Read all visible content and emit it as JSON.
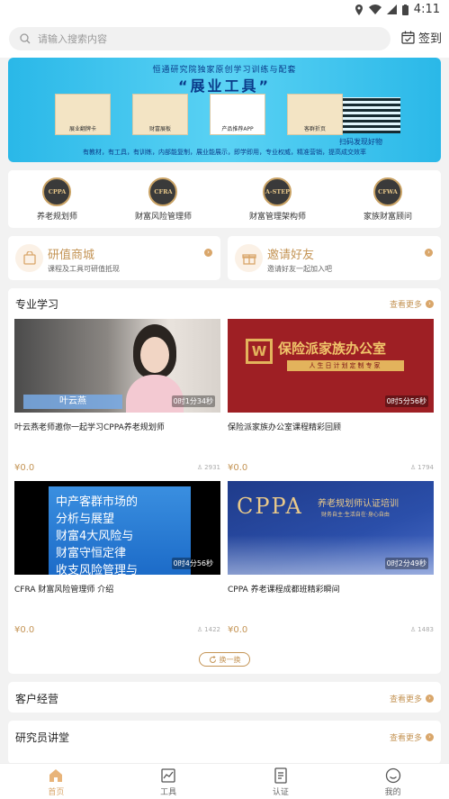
{
  "status_bar": {
    "time": "4:11"
  },
  "header": {
    "search_placeholder": "请输入搜索内容",
    "checkin_label": "签到"
  },
  "banner": {
    "heading": "恒通研究院独家原创学习训练与配套",
    "title": "“展业工具”",
    "items": [
      "展业翻牌卡",
      "财富展板",
      "产品推荐APP",
      "客群折页"
    ],
    "qr_caption": "扫码发现好物",
    "footer": "有教材，有工具，有训练，内部能复制，展业能展示，即学即用，专业权威，精准营销，提高成交效率"
  },
  "categories": [
    {
      "badge": "CPPA",
      "label": "养老规划师"
    },
    {
      "badge": "CFRA",
      "label": "财富风险管理师"
    },
    {
      "badge": "A-STEP",
      "label": "财富管理架构师"
    },
    {
      "badge": "CFWA",
      "label": "家族财富顾问"
    }
  ],
  "promos": [
    {
      "title": "研值商城",
      "subtitle": "课程及工具可研值抵现"
    },
    {
      "title": "邀请好友",
      "subtitle": "邀请好友一起加入吧"
    }
  ],
  "professional": {
    "title": "专业学习",
    "more": "查看更多",
    "refresh_label": "换一换",
    "courses": [
      {
        "title": "叶云燕老师邀你一起学习CPPA养老规划师",
        "price": "¥0.0",
        "views": "2931",
        "duration": "0时1分34秒",
        "overlay": "叶云燕"
      },
      {
        "title": "保险派家族办公室课程精彩回顾",
        "price": "¥0.0",
        "views": "1794",
        "duration": "0时5分56秒",
        "overlay": "保险派家族办公室",
        "overlay_sub": "人生日计划定制专家"
      },
      {
        "title": "CFRA 财富风险管理师 介绍",
        "price": "¥0.0",
        "views": "1422",
        "duration": "0时4分56秒",
        "overlay_lines": [
          "中产客群市场的",
          "分析与展望",
          "财富4大风险与",
          "财富守恒定律",
          "收支风险管理与"
        ]
      },
      {
        "title": "CPPA 养老课程成都班精彩瞬间",
        "price": "¥0.0",
        "views": "1483",
        "duration": "0时2分49秒",
        "overlay": "CPPA",
        "overlay_sub": "养老规划师认证培训",
        "overlay_sub2": "财务自主·生活自在·身心自由"
      }
    ]
  },
  "customer": {
    "title": "客户经营",
    "more": "查看更多"
  },
  "lecture": {
    "title": "研究员讲堂",
    "more": "查看更多"
  },
  "tabs": [
    {
      "label": "首页",
      "icon": "home-icon",
      "active": true
    },
    {
      "label": "工具",
      "icon": "chart-icon"
    },
    {
      "label": "认证",
      "icon": "certificate-icon"
    },
    {
      "label": "我的",
      "icon": "profile-icon"
    }
  ]
}
